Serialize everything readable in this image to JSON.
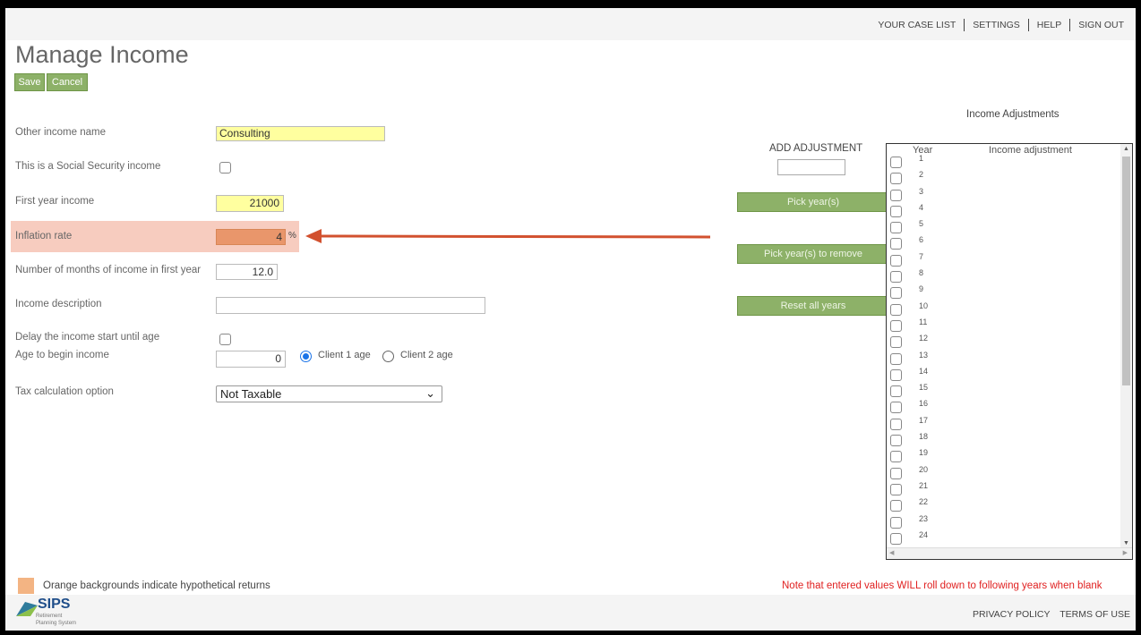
{
  "nav": {
    "links": [
      "YOUR CASE LIST",
      "SETTINGS",
      "HELP",
      "SIGN OUT"
    ]
  },
  "page_title": "Manage Income",
  "actions": {
    "save_label": "Save",
    "cancel_label": "Cancel"
  },
  "form": {
    "other_income_name": {
      "label": "Other income name",
      "value": "Consulting"
    },
    "social_security": {
      "label": "This is a Social Security income",
      "checked": false
    },
    "first_year_income": {
      "label": "First year income",
      "value": "21000"
    },
    "inflation_rate": {
      "label": "Inflation rate",
      "value": "4",
      "unit": "%"
    },
    "months_first_year": {
      "label": "Number of months of income in first year",
      "value": "12.0"
    },
    "income_description": {
      "label": "Income description",
      "value": ""
    },
    "delay_start": {
      "label": "Delay the income start until age",
      "checked": false
    },
    "age_to_begin": {
      "label": "Age to begin income",
      "value": "0",
      "options": [
        "Client 1 age",
        "Client 2 age"
      ],
      "selected": "Client 1 age"
    },
    "tax_option": {
      "label": "Tax calculation option",
      "value": "Not Taxable"
    }
  },
  "adjustments": {
    "add_label": "ADD ADJUSTMENT",
    "pick_years": "Pick year(s)",
    "pick_remove": "Pick year(s) to remove",
    "reset_all": "Reset all years",
    "table_title": "Income Adjustments",
    "col_year": "Year",
    "col_adjustment": "Income adjustment",
    "years": [
      "1",
      "2",
      "3",
      "4",
      "5",
      "6",
      "7",
      "8",
      "9",
      "10",
      "11",
      "12",
      "13",
      "14",
      "15",
      "16",
      "17",
      "18",
      "19",
      "20",
      "21",
      "22",
      "23",
      "24"
    ]
  },
  "footer": {
    "legend": "Orange backgrounds indicate hypothetical returns",
    "note": "Note that entered values WILL roll down to following years when blank",
    "logo_text": "SIPS",
    "logo_sub1": "Retirement",
    "logo_sub2": "Planning System",
    "links": [
      "PRIVACY POLICY",
      "TERMS OF USE"
    ]
  },
  "colors": {
    "accent_green": "#8db168",
    "highlight_orange": "#e9966b",
    "arrow": "#d2512f",
    "note_red": "#e02020"
  },
  "icons": {
    "select_arrow": "chevron-down-icon"
  }
}
